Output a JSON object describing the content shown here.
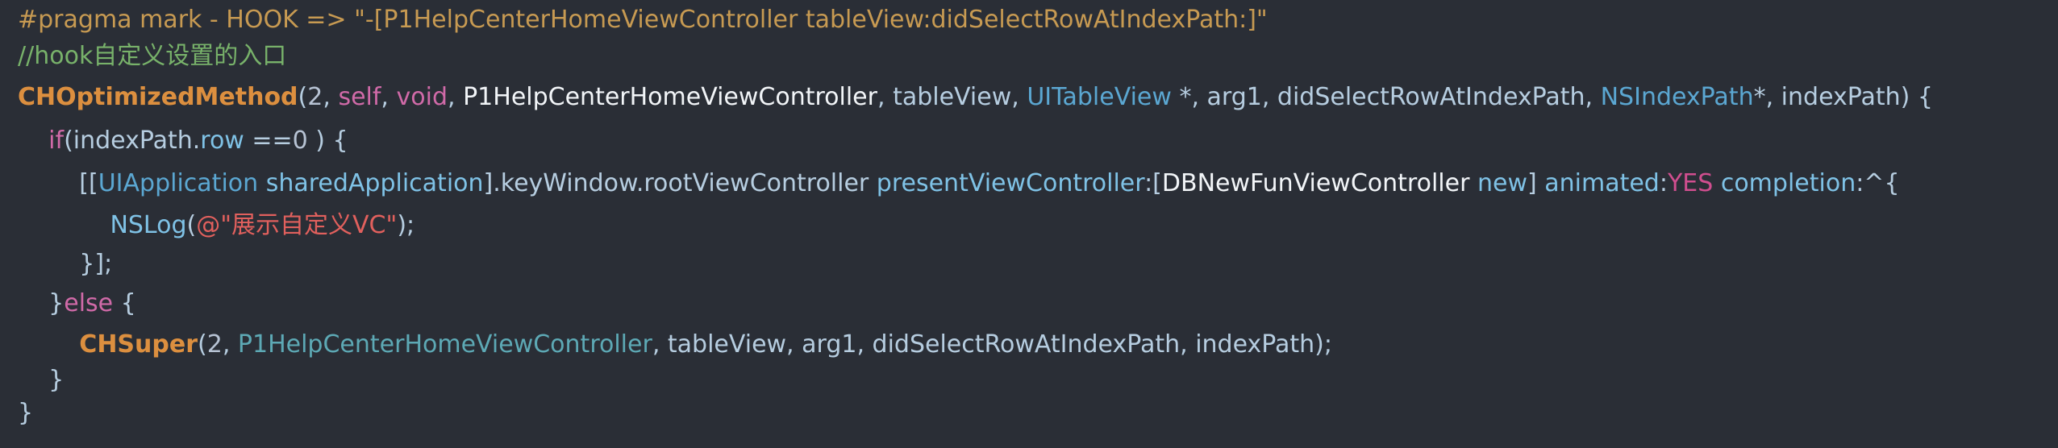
{
  "lines": [
    [
      {
        "t": "#pragma mark - HOOK => \"-[P1HelpCenterHomeViewController tableView:didSelectRowAtIndexPath:]\"",
        "c": "pragma"
      }
    ],
    [
      {
        "t": "//hook自定义设置的入口",
        "c": "comment"
      }
    ],
    [
      {
        "t": "CHOptimizedMethod",
        "c": "macro"
      },
      {
        "t": "(",
        "c": "punct"
      },
      {
        "t": "2",
        "c": "num"
      },
      {
        "t": ", ",
        "c": "punct"
      },
      {
        "t": "self",
        "c": "keyword"
      },
      {
        "t": ", ",
        "c": "punct"
      },
      {
        "t": "void",
        "c": "keyword"
      },
      {
        "t": ", ",
        "c": "punct"
      },
      {
        "t": "P1HelpCenterHomeViewController",
        "c": "white"
      },
      {
        "t": ", ",
        "c": "punct"
      },
      {
        "t": "tableView",
        "c": "plain"
      },
      {
        "t": ", ",
        "c": "punct"
      },
      {
        "t": "UITableView",
        "c": "type"
      },
      {
        "t": " *, ",
        "c": "punct"
      },
      {
        "t": "arg1",
        "c": "plain"
      },
      {
        "t": ", ",
        "c": "punct"
      },
      {
        "t": "didSelectRowAtIndexPath",
        "c": "plain"
      },
      {
        "t": ", ",
        "c": "punct"
      },
      {
        "t": "NSIndexPath",
        "c": "type"
      },
      {
        "t": "*, ",
        "c": "punct"
      },
      {
        "t": "indexPath",
        "c": "plain"
      },
      {
        "t": ") {",
        "c": "punct"
      }
    ],
    [
      {
        "t": "    ",
        "c": "punct"
      },
      {
        "t": "if",
        "c": "keyword"
      },
      {
        "t": "(indexPath.",
        "c": "punct"
      },
      {
        "t": "row",
        "c": "method"
      },
      {
        "t": " ==",
        "c": "punct"
      },
      {
        "t": "0",
        "c": "num"
      },
      {
        "t": " ) {",
        "c": "punct"
      }
    ],
    [
      {
        "t": "        ",
        "c": "punct"
      },
      {
        "t": "[[",
        "c": "punct"
      },
      {
        "t": "UIApplication",
        "c": "type"
      },
      {
        "t": " ",
        "c": "punct"
      },
      {
        "t": "sharedApplication",
        "c": "method"
      },
      {
        "t": "].keyWindow.rootViewController ",
        "c": "punct"
      },
      {
        "t": "presentViewController",
        "c": "method"
      },
      {
        "t": ":[",
        "c": "punct"
      },
      {
        "t": "DBNewFunViewController",
        "c": "white"
      },
      {
        "t": " ",
        "c": "punct"
      },
      {
        "t": "new",
        "c": "method"
      },
      {
        "t": "] ",
        "c": "punct"
      },
      {
        "t": "animated",
        "c": "method"
      },
      {
        "t": ":",
        "c": "punct"
      },
      {
        "t": "YES",
        "c": "yes"
      },
      {
        "t": " ",
        "c": "punct"
      },
      {
        "t": "completion",
        "c": "method"
      },
      {
        "t": ":^{",
        "c": "punct"
      }
    ],
    [
      {
        "t": "            ",
        "c": "punct"
      },
      {
        "t": "NSLog",
        "c": "method"
      },
      {
        "t": "(",
        "c": "punct"
      },
      {
        "t": "@\"展示自定义VC\"",
        "c": "string"
      },
      {
        "t": ");",
        "c": "punct"
      }
    ],
    [
      {
        "t": "        ",
        "c": "punct"
      },
      {
        "t": "}];",
        "c": "punct"
      }
    ],
    [
      {
        "t": "    ",
        "c": "punct"
      },
      {
        "t": "}",
        "c": "punct"
      },
      {
        "t": "else",
        "c": "keyword"
      },
      {
        "t": " {",
        "c": "punct"
      }
    ],
    [
      {
        "t": "        ",
        "c": "punct"
      },
      {
        "t": "CHSuper",
        "c": "macro"
      },
      {
        "t": "(",
        "c": "punct"
      },
      {
        "t": "2",
        "c": "num"
      },
      {
        "t": ", ",
        "c": "punct"
      },
      {
        "t": "P1HelpCenterHomeViewController",
        "c": "class"
      },
      {
        "t": ", tableView, arg1, didSelectRowAtIndexPath, indexPath);",
        "c": "punct"
      }
    ],
    [
      {
        "t": "    ",
        "c": "punct"
      },
      {
        "t": "}",
        "c": "punct"
      }
    ],
    [
      {
        "t": "}",
        "c": "punct"
      }
    ]
  ]
}
